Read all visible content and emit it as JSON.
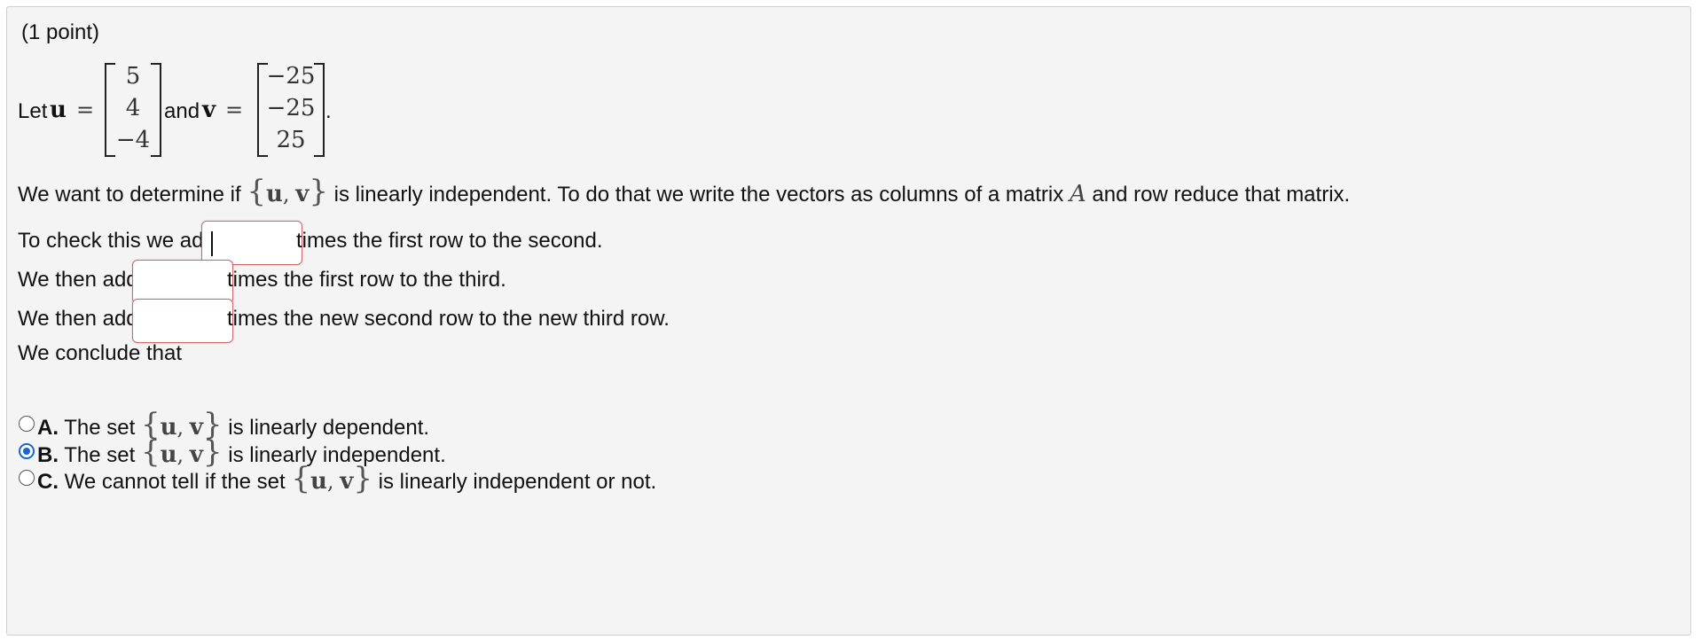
{
  "problem": {
    "points": "(1 point)",
    "let_prefix": "Let",
    "u_symbol": "u",
    "equals": "=",
    "and_text": "and",
    "v_symbol": "v",
    "period": ".",
    "u_entries": [
      "5",
      "4",
      "−4"
    ],
    "v_entries": [
      "−25",
      "−25",
      "25"
    ],
    "intro_part1": "We want to determine if",
    "set_open": "{",
    "set_u": "u",
    "set_comma": ",",
    "set_v": "v",
    "set_close": "}",
    "intro_part2": "is linearly independent. To do that we write the vectors as columns of a matrix",
    "matrix_symbol": "A",
    "intro_part3": "and row reduce that matrix."
  },
  "steps": [
    {
      "prefix": "To check this we add",
      "suffix": "times the first row to the second.",
      "value": ""
    },
    {
      "prefix": "We then add",
      "suffix": "times the first row to the third.",
      "value": ""
    },
    {
      "prefix": "We then add",
      "suffix": "times the new second row to the new third row.",
      "value": ""
    }
  ],
  "conclusion_label": "We conclude that",
  "options": [
    {
      "letter": "A.",
      "prefix": "The set",
      "suffix": "is linearly dependent.",
      "checked": false
    },
    {
      "letter": "B.",
      "prefix": "The set",
      "suffix": "is linearly independent.",
      "checked": true
    },
    {
      "letter": "C.",
      "prefix": "We cannot tell if the set",
      "suffix": "is linearly independent or not.",
      "checked": false
    }
  ],
  "colors": {
    "radio_selected": "#1a64d6",
    "input_border": "#c86a6a",
    "panel_background": "#f4f4f4"
  }
}
